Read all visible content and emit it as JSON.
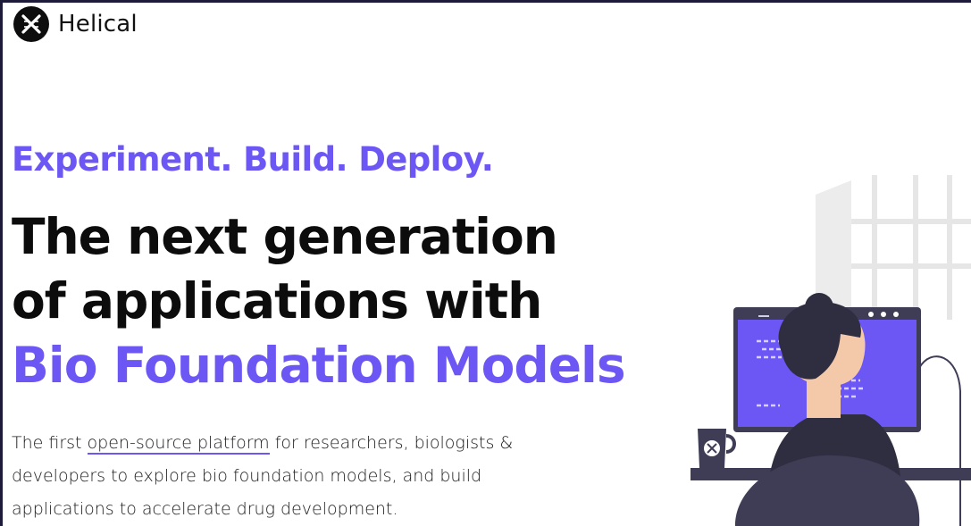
{
  "header": {
    "brand": "Helical",
    "logo_icon": "helical-logo-icon"
  },
  "hero": {
    "eyebrow": "Experiment. Build. Deploy.",
    "headline_line1": "The next generation",
    "headline_line2": "of applications with",
    "headline_accent": "Bio Foundation Models",
    "desc_before": "The first ",
    "desc_link": "open-source platform",
    "desc_after": " for researchers, biologists & developers to explore bio foundation models, and build applications to accelerate drug development."
  },
  "illustration": {
    "icon": "developer-at-computer-illustration"
  },
  "colors": {
    "accent": "#6c57f5",
    "text": "#0c0c0c",
    "frame": "#1e1b3a"
  }
}
